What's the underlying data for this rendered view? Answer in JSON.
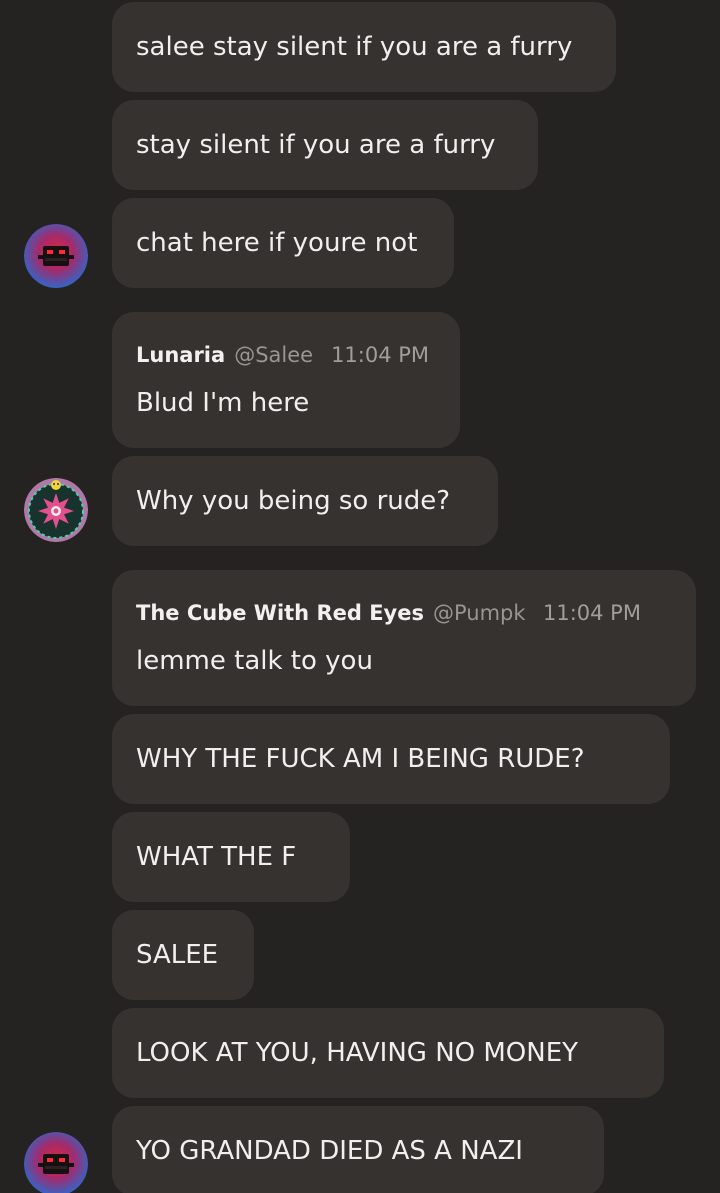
{
  "messages": [
    {
      "text": "salee stay silent if you are a furry"
    },
    {
      "text": "stay silent if you are a furry"
    },
    {
      "text": "chat here if youre not",
      "avatar": "red-eyed-cube-avatar"
    },
    {
      "reply": {
        "name": "Lunaria",
        "handle": "@Salee",
        "time": "11:04 PM"
      },
      "text": "Blud I'm here"
    },
    {
      "text": "Why you being so rude?",
      "avatar": "mandala-avatar"
    },
    {
      "reply": {
        "name": "The Cube With Red Eyes",
        "handle": "@Pumpk",
        "time": "11:04 PM"
      },
      "text": "lemme talk to you"
    },
    {
      "text": "WHY THE FUCK AM I BEING RUDE?"
    },
    {
      "text": "WHAT THE F"
    },
    {
      "text": "SALEE"
    },
    {
      "text": "LOOK AT YOU, HAVING NO MONEY"
    },
    {
      "text": "YO GRANDAD DIED AS A NAZI",
      "avatar": "red-eyed-cube-avatar"
    }
  ],
  "colors": {
    "background": "#252321",
    "bubble": "#363230",
    "text": "#f1efee",
    "muted": "#9a9593"
  }
}
